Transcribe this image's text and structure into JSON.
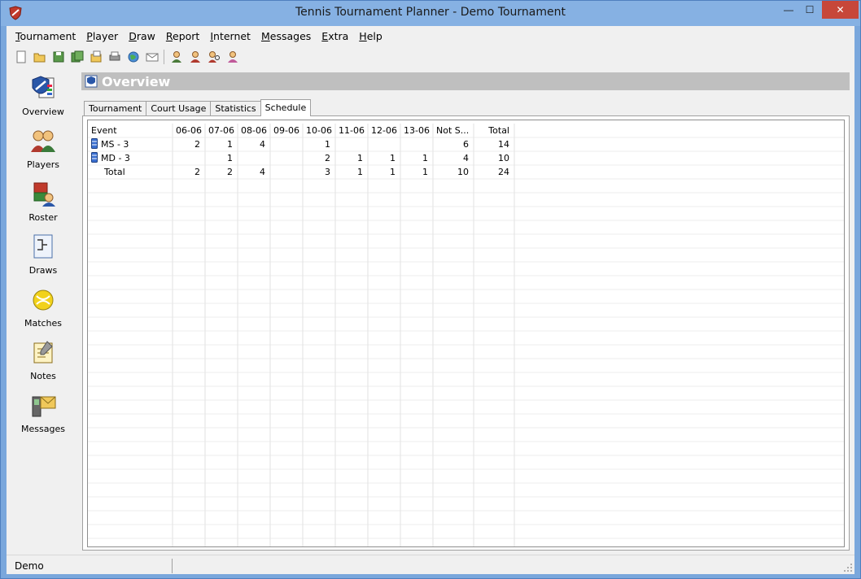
{
  "window": {
    "title": "Tennis Tournament Planner - Demo Tournament",
    "minimize_glyph": "—",
    "maximize_glyph": "☐",
    "close_glyph": "✕"
  },
  "menu": [
    "Tournament",
    "Player",
    "Draw",
    "Report",
    "Internet",
    "Messages",
    "Extra",
    "Help"
  ],
  "toolbar_icons": [
    "new-icon",
    "open-icon",
    "save-icon",
    "save-all-icon",
    "properties-icon",
    "print-icon",
    "internet-icon",
    "email-icon",
    "player-icon",
    "player-alt-icon",
    "player-search-icon",
    "player-add-icon"
  ],
  "sidebar": {
    "items": [
      {
        "label": "Overview",
        "icon": "overview-icon"
      },
      {
        "label": "Players",
        "icon": "players-icon"
      },
      {
        "label": "Roster",
        "icon": "roster-icon"
      },
      {
        "label": "Draws",
        "icon": "draws-icon"
      },
      {
        "label": "Matches",
        "icon": "matches-icon"
      },
      {
        "label": "Notes",
        "icon": "notes-icon"
      },
      {
        "label": "Messages",
        "icon": "messages-icon"
      }
    ]
  },
  "header": {
    "title": "Overview"
  },
  "tabs": [
    {
      "label": "Tournament",
      "active": false
    },
    {
      "label": "Court Usage",
      "active": false
    },
    {
      "label": "Statistics",
      "active": false
    },
    {
      "label": "Schedule",
      "active": true
    }
  ],
  "grid": {
    "columns": [
      "Event",
      "06-06",
      "07-06",
      "08-06",
      "09-06",
      "10-06",
      "11-06",
      "12-06",
      "13-06",
      "Not S...",
      "Total"
    ],
    "rows": [
      {
        "event": "MS - 3",
        "has_icon": true,
        "cells": [
          "2",
          "1",
          "4",
          "",
          "1",
          "",
          "",
          "",
          "6",
          "14"
        ]
      },
      {
        "event": "MD - 3",
        "has_icon": true,
        "cells": [
          "",
          "1",
          "",
          "",
          "2",
          "1",
          "1",
          "1",
          "4",
          "10"
        ]
      },
      {
        "event": "Total",
        "has_icon": false,
        "cells": [
          "2",
          "2",
          "4",
          "",
          "3",
          "1",
          "1",
          "1",
          "10",
          "24"
        ]
      }
    ]
  },
  "status": {
    "text": "Demo"
  },
  "colors": {
    "accent_blue": "#86b1e3",
    "header_gray": "#bfbfbf",
    "close_red": "#c7473a"
  }
}
